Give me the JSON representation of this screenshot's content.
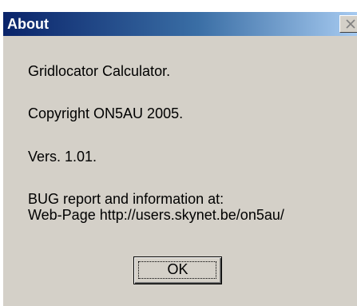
{
  "window": {
    "title": "About",
    "close_icon": "close-icon"
  },
  "content": {
    "app_name": "Gridlocator Calculator.",
    "copyright": "Copyright ON5AU 2005.",
    "version": "Vers. 1.01.",
    "bug_report": "BUG report and information at:",
    "web_page": "Web-Page http://users.skynet.be/on5au/"
  },
  "buttons": {
    "ok_label": "OK"
  },
  "colors": {
    "titlebar_start": "#0a246a",
    "titlebar_end": "#a6caf0",
    "dialog_bg": "#d4d0c8"
  }
}
